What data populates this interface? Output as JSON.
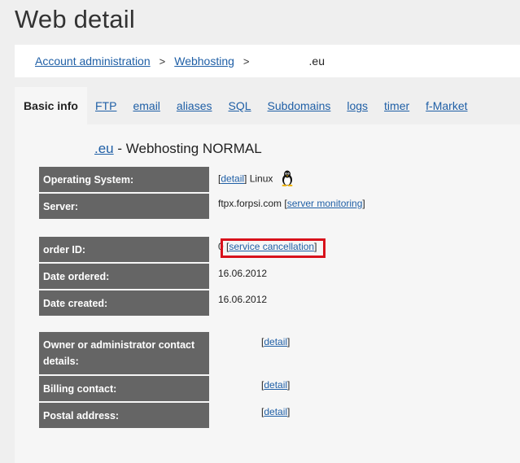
{
  "page": {
    "title": "Web detail"
  },
  "breadcrumb": {
    "items": [
      "Account administration",
      "Webhosting"
    ],
    "current": ".eu",
    "separator": ">"
  },
  "tabs": [
    {
      "label": "Basic info",
      "active": true
    },
    {
      "label": "FTP"
    },
    {
      "label": "email"
    },
    {
      "label": "aliases"
    },
    {
      "label": "SQL"
    },
    {
      "label": "Subdomains"
    },
    {
      "label": "logs"
    },
    {
      "label": "timer"
    },
    {
      "label": "f-Market"
    }
  ],
  "heading": {
    "domain_link": ".eu",
    "text": " - Webhosting NORMAL"
  },
  "rows": {
    "os": {
      "label": "Operating System:",
      "detail_link": "detail",
      "value": "Linux"
    },
    "server": {
      "label": "Server:",
      "value": "ftpx.forpsi.com",
      "monitoring_link": "server monitoring"
    },
    "order": {
      "label": "order ID:",
      "value": "0",
      "cancel_link": "service cancellation"
    },
    "date_ordered": {
      "label": "Date ordered:",
      "value": "16.06.2012"
    },
    "date_created": {
      "label": "Date created:",
      "value": "16.06.2012"
    },
    "owner": {
      "label": "Owner or administrator contact details:",
      "detail_link": "detail"
    },
    "billing": {
      "label": "Billing contact:",
      "detail_link": "detail"
    },
    "postal": {
      "label": "Postal address:",
      "detail_link": "detail"
    }
  },
  "colors": {
    "background": "#efefef",
    "panel": "#f6f6f6",
    "label_bg": "#656565",
    "link": "#1f5fa6",
    "highlight": "#d8121b"
  },
  "icons": {
    "os_icon": "tux-penguin-icon"
  }
}
